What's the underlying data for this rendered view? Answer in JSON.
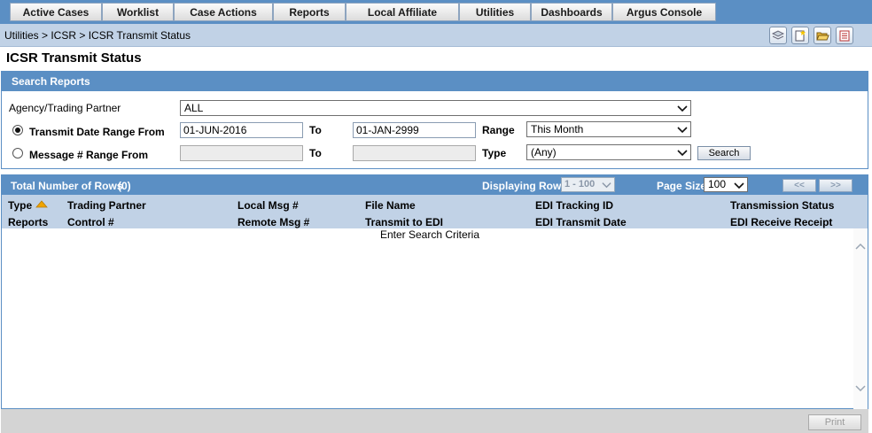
{
  "menu": [
    "Active Cases",
    "Worklist",
    "Case Actions",
    "Reports",
    "Local Affiliate",
    "Utilities",
    "Dashboards",
    "Argus Console"
  ],
  "breadcrumb": "Utilities > ICSR > ICSR Transmit Status",
  "page_title": "ICSR Transmit Status",
  "search": {
    "header": "Search Reports",
    "agency_label": "Agency/Trading Partner",
    "agency_value": "ALL",
    "date_label": "Transmit Date Range From",
    "date_from": "01-JUN-2016",
    "to_label": "To",
    "date_to": "01-JAN-2999",
    "range_label": "Range",
    "range_value": "This Month",
    "msg_label": "Message # Range From",
    "msg_from": "",
    "msg_to": "",
    "type_label": "Type",
    "type_value": "(Any)",
    "search_button": "Search",
    "selected_mode": "date"
  },
  "results": {
    "total_label": "Total Number of Rows",
    "total_count": "(0)",
    "displaying_label": "Displaying Rows",
    "displaying_value": "1 - 100",
    "page_size_label": "Page Size",
    "page_size_value": "100",
    "prev_button": "<<",
    "next_button": ">>",
    "columns_row1": [
      "Type",
      "Trading Partner",
      "Local Msg #",
      "File Name",
      "EDI Tracking ID",
      "Transmission Status"
    ],
    "columns_row2": [
      "Reports",
      "Control #",
      "Remote Msg #",
      "Transmit to EDI",
      "EDI Transmit Date",
      "EDI Receive Receipt"
    ],
    "empty_message": "Enter Search Criteria"
  },
  "footer": {
    "print_button": "Print"
  },
  "colors": {
    "accent": "#5b8fc4",
    "header_light": "#c1d2e6",
    "sort_arrow": "#f0a400"
  }
}
